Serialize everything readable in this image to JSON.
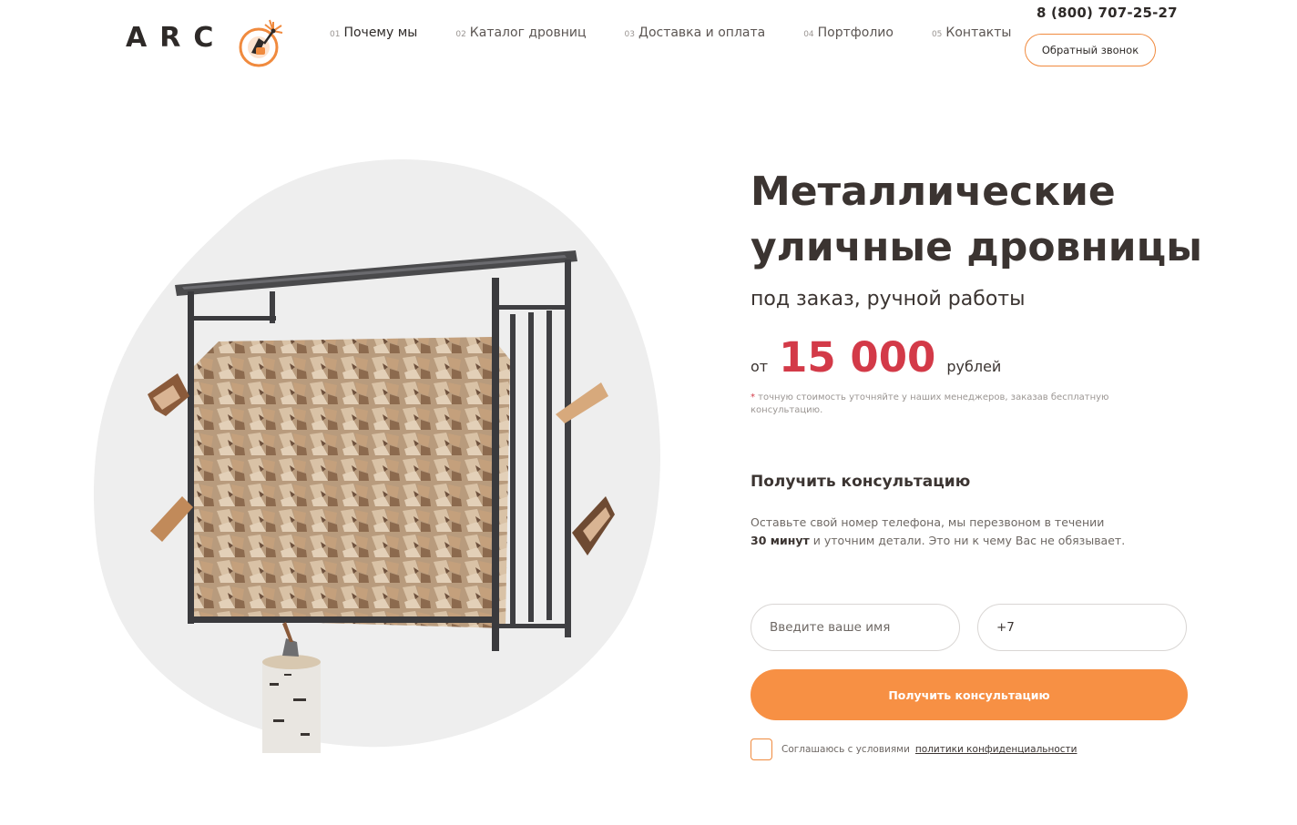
{
  "header": {
    "logo_text": "ARC",
    "nav": [
      {
        "num": "01",
        "label": "Почему мы"
      },
      {
        "num": "02",
        "label": "Каталог дровниц"
      },
      {
        "num": "03",
        "label": "Доставка и оплата"
      },
      {
        "num": "04",
        "label": "Портфолио"
      },
      {
        "num": "05",
        "label": "Контакты"
      }
    ],
    "phone": "8 (800) 707-25-27",
    "callback_label": "Обратный звонок"
  },
  "hero": {
    "title": "Металлические уличные дровницы",
    "subtitle": "под заказ, ручной работы",
    "price_from": "от",
    "price_value": "15 000",
    "price_unit": "рублей",
    "note_star": "*",
    "note_text": " точную стоимость уточняйте у наших менеджеров, заказав бесплатную консультацию.",
    "image_icon": "firewood-rack-illustration"
  },
  "consult": {
    "title": "Получить консультацию",
    "text_part1": "Оставьте свой номер телефона, мы перезвоном в течении",
    "text_bold": "30 минут",
    "text_part2": " и уточним детали. Это ни к чему Вас не обязывает.",
    "name_placeholder": "Введите ваше имя",
    "phone_value": "+7",
    "submit_label": "Получить консультацию",
    "agree_text": "Соглашаюсь с условиями",
    "agree_link": "политики конфиденциальности"
  },
  "colors": {
    "accent": "#f79044",
    "price": "#d33a48",
    "text": "#3b3431"
  }
}
